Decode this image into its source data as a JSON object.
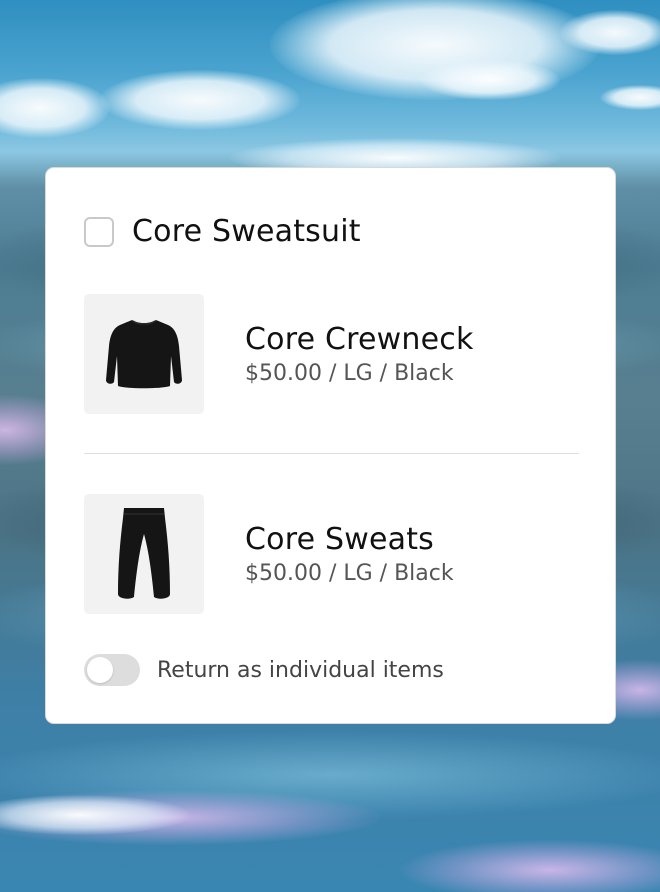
{
  "bundle": {
    "title": "Core Sweatsuit",
    "checked": false
  },
  "items": [
    {
      "name": "Core Crewneck",
      "meta": "$50.00 / LG / Black",
      "icon": "crewneck-sweatshirt-image"
    },
    {
      "name": "Core Sweats",
      "meta": "$50.00 / LG / Black",
      "icon": "sweatpants-image"
    }
  ],
  "toggle": {
    "label": "Return as individual items",
    "on": false
  },
  "colors": {
    "card_bg": "#ffffff",
    "title_text": "#111111",
    "meta_text": "#555555",
    "thumb_bg": "#f2f2f2",
    "toggle_off": "#dddddd",
    "garment": "#151515"
  }
}
